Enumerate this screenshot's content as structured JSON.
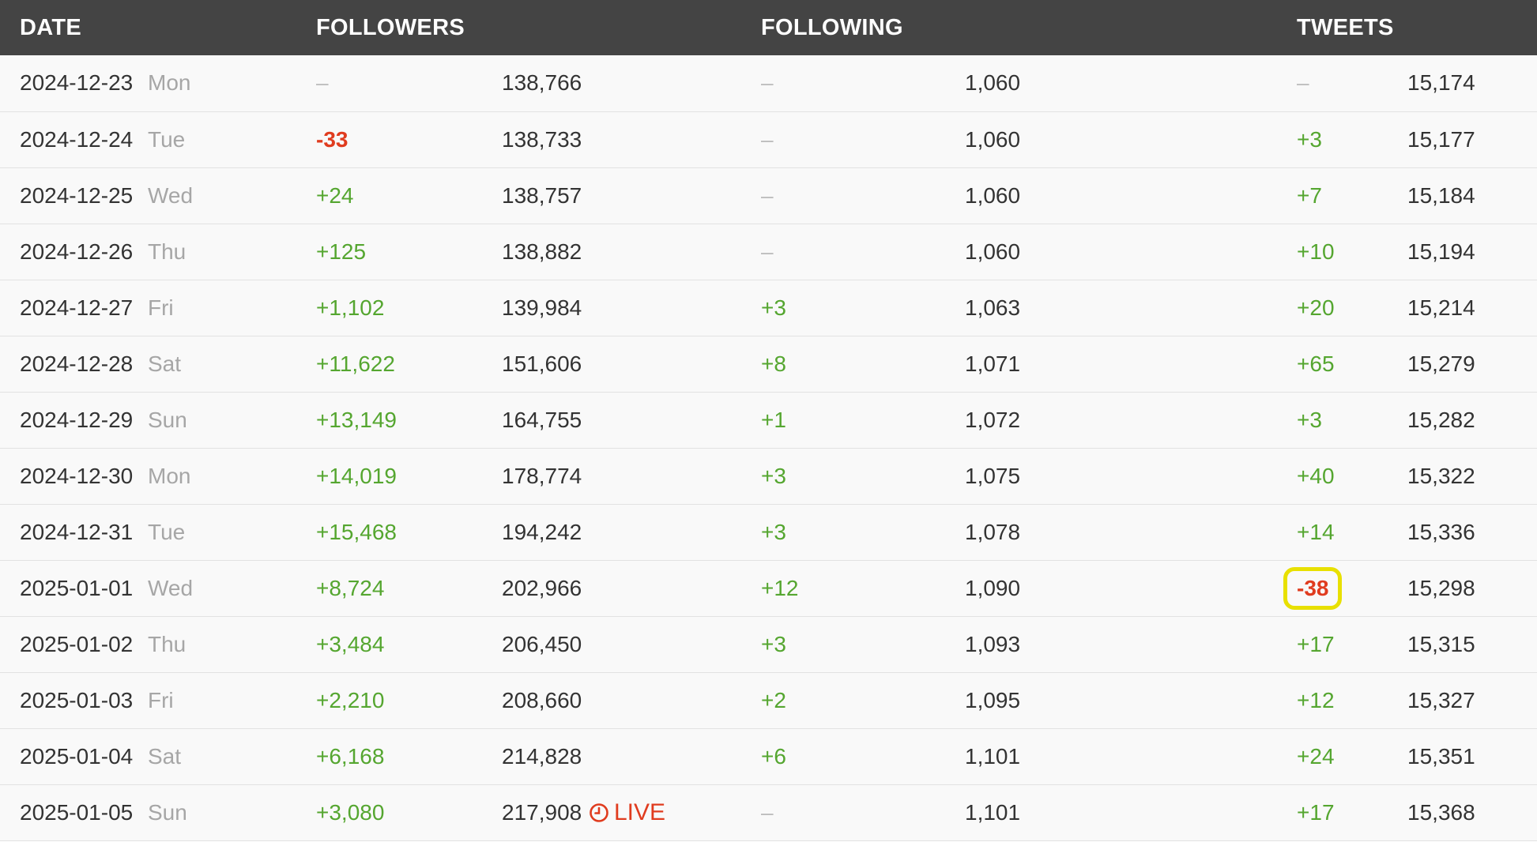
{
  "colors": {
    "header_bg": "#444444",
    "positive": "#55a630",
    "negative": "#e03c1f",
    "highlight_box": "#e8e000",
    "row_bg": "#f9f9f9"
  },
  "header": {
    "date": "DATE",
    "followers": "FOLLOWERS",
    "following": "FOLLOWING",
    "tweets": "TWEETS"
  },
  "live_label": "LIVE",
  "rows": [
    {
      "date": "2024-12-23",
      "day": "Mon",
      "followers_delta": "–",
      "followers": "138,766",
      "following_delta": "–",
      "following": "1,060",
      "tweets_delta": "–",
      "tweets": "15,174"
    },
    {
      "date": "2024-12-24",
      "day": "Tue",
      "followers_delta": "-33",
      "followers": "138,733",
      "following_delta": "–",
      "following": "1,060",
      "tweets_delta": "+3",
      "tweets": "15,177"
    },
    {
      "date": "2024-12-25",
      "day": "Wed",
      "followers_delta": "+24",
      "followers": "138,757",
      "following_delta": "–",
      "following": "1,060",
      "tweets_delta": "+7",
      "tweets": "15,184"
    },
    {
      "date": "2024-12-26",
      "day": "Thu",
      "followers_delta": "+125",
      "followers": "138,882",
      "following_delta": "–",
      "following": "1,060",
      "tweets_delta": "+10",
      "tweets": "15,194"
    },
    {
      "date": "2024-12-27",
      "day": "Fri",
      "followers_delta": "+1,102",
      "followers": "139,984",
      "following_delta": "+3",
      "following": "1,063",
      "tweets_delta": "+20",
      "tweets": "15,214"
    },
    {
      "date": "2024-12-28",
      "day": "Sat",
      "followers_delta": "+11,622",
      "followers": "151,606",
      "following_delta": "+8",
      "following": "1,071",
      "tweets_delta": "+65",
      "tweets": "15,279"
    },
    {
      "date": "2024-12-29",
      "day": "Sun",
      "followers_delta": "+13,149",
      "followers": "164,755",
      "following_delta": "+1",
      "following": "1,072",
      "tweets_delta": "+3",
      "tweets": "15,282"
    },
    {
      "date": "2024-12-30",
      "day": "Mon",
      "followers_delta": "+14,019",
      "followers": "178,774",
      "following_delta": "+3",
      "following": "1,075",
      "tweets_delta": "+40",
      "tweets": "15,322"
    },
    {
      "date": "2024-12-31",
      "day": "Tue",
      "followers_delta": "+15,468",
      "followers": "194,242",
      "following_delta": "+3",
      "following": "1,078",
      "tweets_delta": "+14",
      "tweets": "15,336"
    },
    {
      "date": "2025-01-01",
      "day": "Wed",
      "followers_delta": "+8,724",
      "followers": "202,966",
      "following_delta": "+12",
      "following": "1,090",
      "tweets_delta": "-38",
      "tweets": "15,298",
      "highlight": "tweets_delta"
    },
    {
      "date": "2025-01-02",
      "day": "Thu",
      "followers_delta": "+3,484",
      "followers": "206,450",
      "following_delta": "+3",
      "following": "1,093",
      "tweets_delta": "+17",
      "tweets": "15,315"
    },
    {
      "date": "2025-01-03",
      "day": "Fri",
      "followers_delta": "+2,210",
      "followers": "208,660",
      "following_delta": "+2",
      "following": "1,095",
      "tweets_delta": "+12",
      "tweets": "15,327"
    },
    {
      "date": "2025-01-04",
      "day": "Sat",
      "followers_delta": "+6,168",
      "followers": "214,828",
      "following_delta": "+6",
      "following": "1,101",
      "tweets_delta": "+24",
      "tweets": "15,351"
    },
    {
      "date": "2025-01-05",
      "day": "Sun",
      "followers_delta": "+3,080",
      "followers": "217,908",
      "following_delta": "–",
      "following": "1,101",
      "tweets_delta": "+17",
      "tweets": "15,368",
      "live": true
    }
  ]
}
